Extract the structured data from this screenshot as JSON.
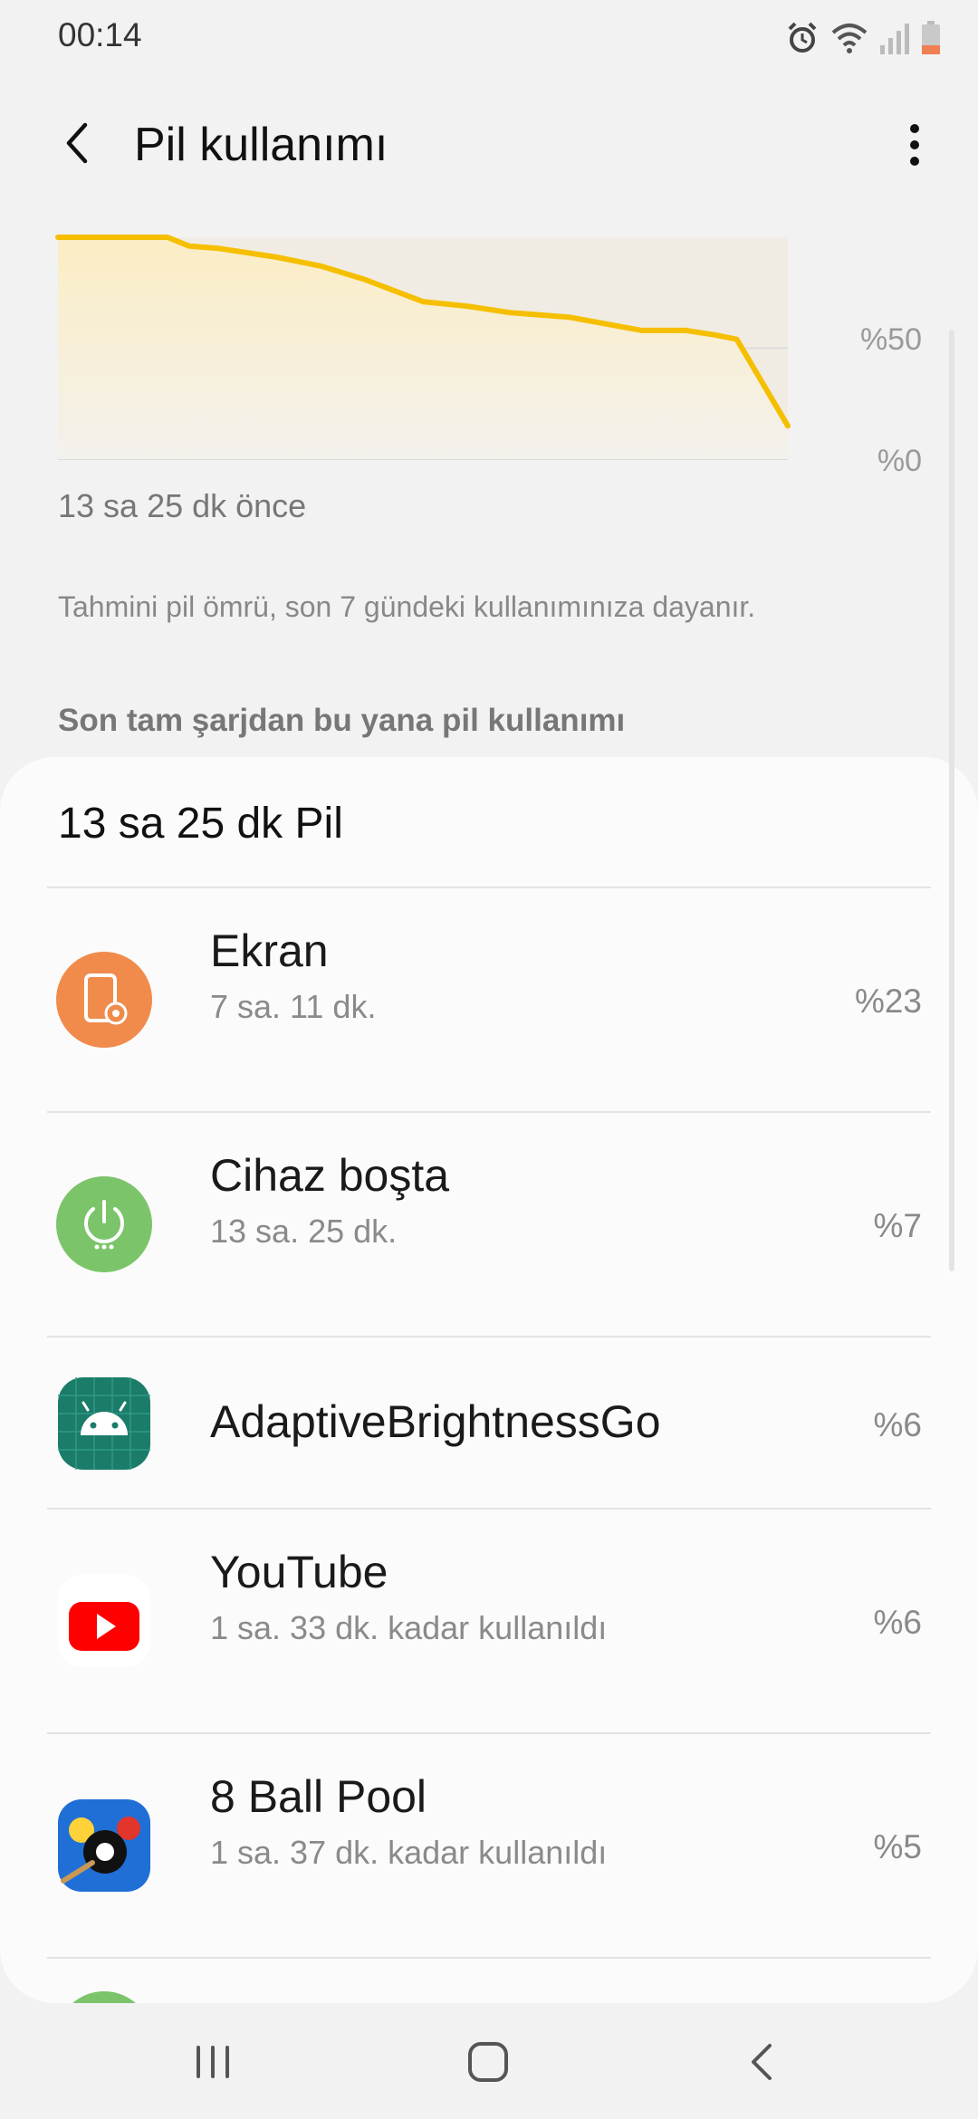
{
  "status_bar": {
    "time": "00:14"
  },
  "header": {
    "title": "Pil kullanımı"
  },
  "chart_data": {
    "type": "area",
    "x_label_start": "13 sa 25 dk önce",
    "y_tick_labels": [
      "%50",
      "%0"
    ],
    "ylim": [
      0,
      100
    ],
    "x": [
      0.0,
      0.15,
      0.18,
      0.22,
      0.3,
      0.36,
      0.42,
      0.5,
      0.56,
      0.62,
      0.7,
      0.8,
      0.86,
      0.9,
      0.93,
      1.0
    ],
    "values": [
      100,
      100,
      96,
      95,
      91,
      87,
      81,
      71,
      69,
      66,
      64,
      58,
      58,
      56,
      54,
      15
    ],
    "line_color": "#f5bf00",
    "fill_color": "#fbedc4"
  },
  "info_text": "Tahmini pil ömrü, son 7 gündeki kullanımınıza dayanır.",
  "section_title": "Son tam şarjdan bu yana pil kullanımı",
  "card": {
    "title": "13 sa 25 dk Pil",
    "items": [
      {
        "name": "Ekran",
        "sub": "7 sa. 11 dk.",
        "pct": "%23",
        "icon": "screen-icon",
        "color": "#f08b4c"
      },
      {
        "name": "Cihaz boşta",
        "sub": "13 sa. 25 dk.",
        "pct": "%7",
        "icon": "power-idle-icon",
        "color": "#7cc46a"
      },
      {
        "name": "AdaptiveBrightnessGo",
        "sub": "",
        "pct": "%6",
        "icon": "android-app-icon",
        "color": "#1b7c6a"
      },
      {
        "name": "YouTube",
        "sub": "1 sa. 33 dk. kadar kullanıldı",
        "pct": "%6",
        "icon": "youtube-icon",
        "color": "#ff0000"
      },
      {
        "name": "8 Ball Pool",
        "sub": "1 sa. 37 dk. kadar kullanıldı",
        "pct": "%5",
        "icon": "8-ball-pool-icon",
        "color": "#1f6fd6"
      }
    ]
  }
}
